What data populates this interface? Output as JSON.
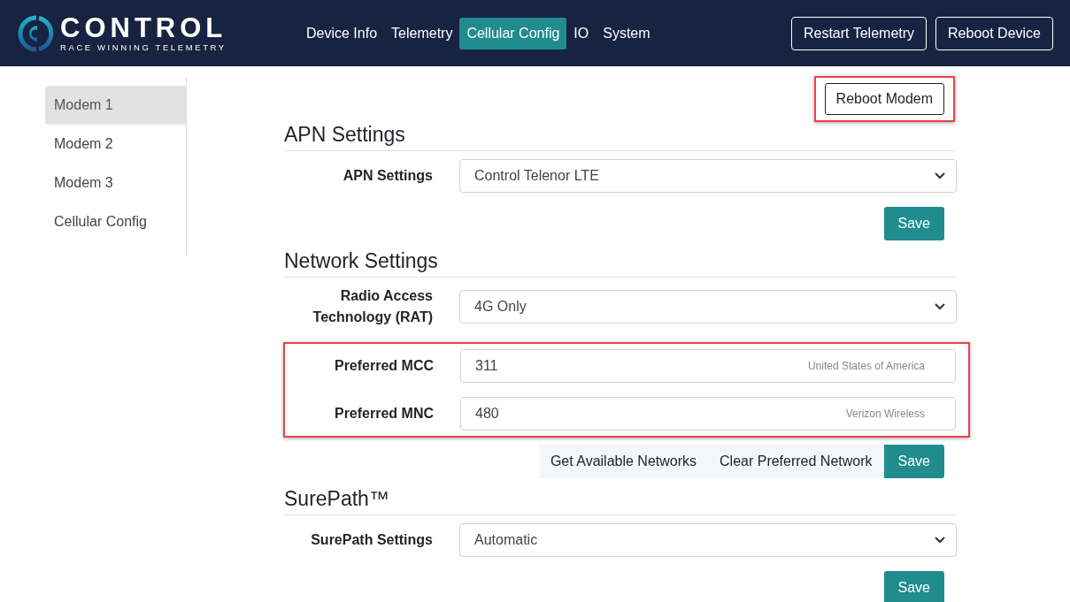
{
  "header": {
    "logo": {
      "name": "CONTROL",
      "tagline": "RACE WINNING TELEMETRY"
    },
    "nav": [
      {
        "label": "Device Info",
        "selected": false
      },
      {
        "label": "Telemetry",
        "selected": false
      },
      {
        "label": "Cellular Config",
        "selected": true
      },
      {
        "label": "IO",
        "selected": false
      },
      {
        "label": "System",
        "selected": false
      }
    ],
    "actions": [
      "Restart Telemetry",
      "Reboot Device"
    ]
  },
  "sidebar": {
    "items": [
      {
        "label": "Modem 1",
        "selected": true
      },
      {
        "label": "Modem 2",
        "selected": false
      },
      {
        "label": "Modem 3",
        "selected": false
      },
      {
        "label": "Cellular Config",
        "selected": false
      }
    ]
  },
  "top_action": {
    "label": "Reboot Modem",
    "highlighted": true
  },
  "sections": [
    {
      "heading": "APN Settings",
      "rows": [
        {
          "label": "APN Settings",
          "kind": "select",
          "value": "Control Telenor LTE",
          "highlighted": false
        }
      ],
      "buttons": [
        {
          "label": "Save",
          "kind": "primary"
        }
      ]
    },
    {
      "heading": "Network Settings",
      "rows": [
        {
          "label": "Radio Access Technology (RAT)",
          "kind": "select",
          "value": "4G Only",
          "highlighted": false
        },
        {
          "label": "Preferred MCC",
          "kind": "input",
          "value": "311",
          "hint": "United States of America",
          "highlighted": true
        },
        {
          "label": "Preferred MNC",
          "kind": "input",
          "value": "480",
          "hint": "Verizon Wireless",
          "highlighted": true
        }
      ],
      "buttons": [
        {
          "label": "Get Available Networks",
          "kind": "light"
        },
        {
          "label": "Clear Preferred Network",
          "kind": "light"
        },
        {
          "label": "Save",
          "kind": "primary"
        }
      ]
    },
    {
      "heading": "SurePath™",
      "rows": [
        {
          "label": "SurePath Settings",
          "kind": "select",
          "value": "Automatic",
          "highlighted": false
        }
      ],
      "buttons": [
        {
          "label": "Save",
          "kind": "primary"
        }
      ]
    }
  ]
}
